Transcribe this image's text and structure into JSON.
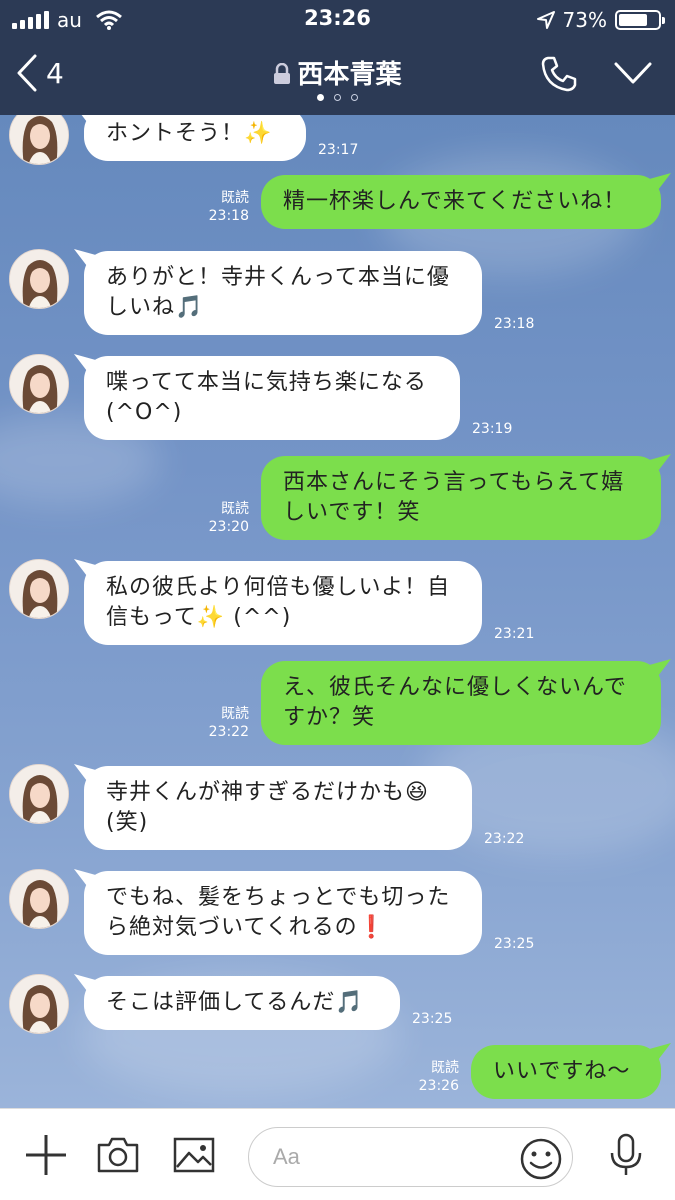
{
  "status_bar": {
    "carrier": "au",
    "time": "23:26",
    "battery": "73%",
    "battery_level": 0.73
  },
  "nav": {
    "back_count": "4",
    "title": "西本青葉",
    "page_count": 3,
    "active_page": 0
  },
  "messages": [
    {
      "side": "in",
      "text": "ホントそう！✨",
      "time": "23:17"
    },
    {
      "side": "out",
      "text": "精一杯楽しんで来てくださいね！",
      "read": "既読",
      "time": "23:18"
    },
    {
      "side": "in",
      "text": "ありがと！寺井くんって本当に優\nしいね🎵",
      "time": "23:18"
    },
    {
      "side": "in",
      "text": "喋ってて本当に気持ち楽になる\n(^O^)",
      "time": "23:19"
    },
    {
      "side": "out",
      "text": "西本さんにそう言ってもらえて嬉\nしいです！笑",
      "read": "既読",
      "time": "23:20"
    },
    {
      "side": "in",
      "text": "私の彼氏より何倍も優しいよ！自\n信もって✨ (^^)",
      "time": "23:21"
    },
    {
      "side": "out",
      "text": "え、彼氏そんなに優しくないんで\nすか？笑",
      "read": "既読",
      "time": "23:22"
    },
    {
      "side": "in",
      "text": "寺井くんが神すぎるだけかも😆\n(笑)",
      "time": "23:22"
    },
    {
      "side": "in",
      "text": "でもね、髪をちょっとでも切った\nら絶対気づいてくれるの❗️",
      "time": "23:25"
    },
    {
      "side": "in",
      "text": "そこは評価してるんだ🎵",
      "time": "23:25"
    },
    {
      "side": "out",
      "text": "いいですね〜",
      "read": "既読",
      "time": "23:26"
    }
  ],
  "input": {
    "placeholder": "Aa"
  },
  "icons": {
    "back": "chevron-left-icon",
    "lock": "lock-icon",
    "call": "phone-icon",
    "menu": "chevron-down-icon",
    "add": "plus-icon",
    "camera": "camera-icon",
    "image": "image-icon",
    "emoji": "smiley-icon",
    "mic": "microphone-icon"
  },
  "colors": {
    "header": "#2c3a55",
    "outgoing_bubble": "#7cde4c",
    "incoming_bubble": "#ffffff",
    "background": "#7494c7"
  }
}
